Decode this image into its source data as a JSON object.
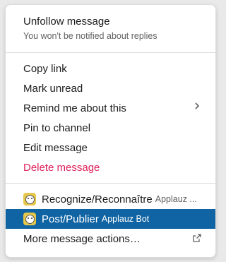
{
  "header": {
    "title": "Unfollow message",
    "subtitle": "You won't be notified about replies"
  },
  "actions": {
    "copy_link": "Copy link",
    "mark_unread": "Mark unread",
    "remind": "Remind me about this",
    "pin": "Pin to channel",
    "edit": "Edit message",
    "delete": "Delete message"
  },
  "shortcuts": [
    {
      "label": "Recognize/Reconnaître",
      "app": "Applauz ..."
    },
    {
      "label": "Post/Publier",
      "app": "Applauz Bot"
    }
  ],
  "more": "More message actions…",
  "colors": {
    "danger": "#e01e5a",
    "highlight": "#1164a3"
  }
}
